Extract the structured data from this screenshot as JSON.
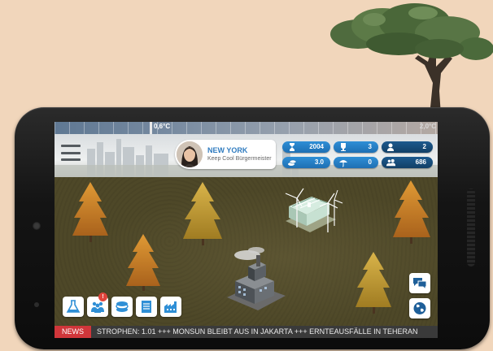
{
  "temperature": {
    "current": "0,6°C",
    "limit": "2,0°C"
  },
  "city": {
    "name": "NEW YORK",
    "role": "Keep Cool Bürgermeister"
  },
  "stats": {
    "year": "2004",
    "trophies": "3",
    "population_co2": "2",
    "coins": "3.0",
    "umbrella": "0",
    "co2_total": "686"
  },
  "toolbar": {
    "notification_count": "!"
  },
  "news": {
    "label": "NEWS",
    "text": "STROPHEN: 1.01 +++ MONSUN BLEIBT AUS IN JAKARTA +++ ERNTEAUSFÄLLE IN TEHERAN"
  },
  "icons": [
    "menu-icon",
    "hourglass-icon",
    "trophy-icon",
    "person-co2-icon",
    "coins-icon",
    "umbrella-icon",
    "group-co2-icon",
    "flask-icon",
    "people-icon",
    "money-icon",
    "document-icon",
    "factory-icon",
    "chat-icon",
    "globe-icon"
  ],
  "colors": {
    "accent": "#2f8fd6",
    "news_label": "#d0363a",
    "city_name": "#2f7bbf"
  }
}
